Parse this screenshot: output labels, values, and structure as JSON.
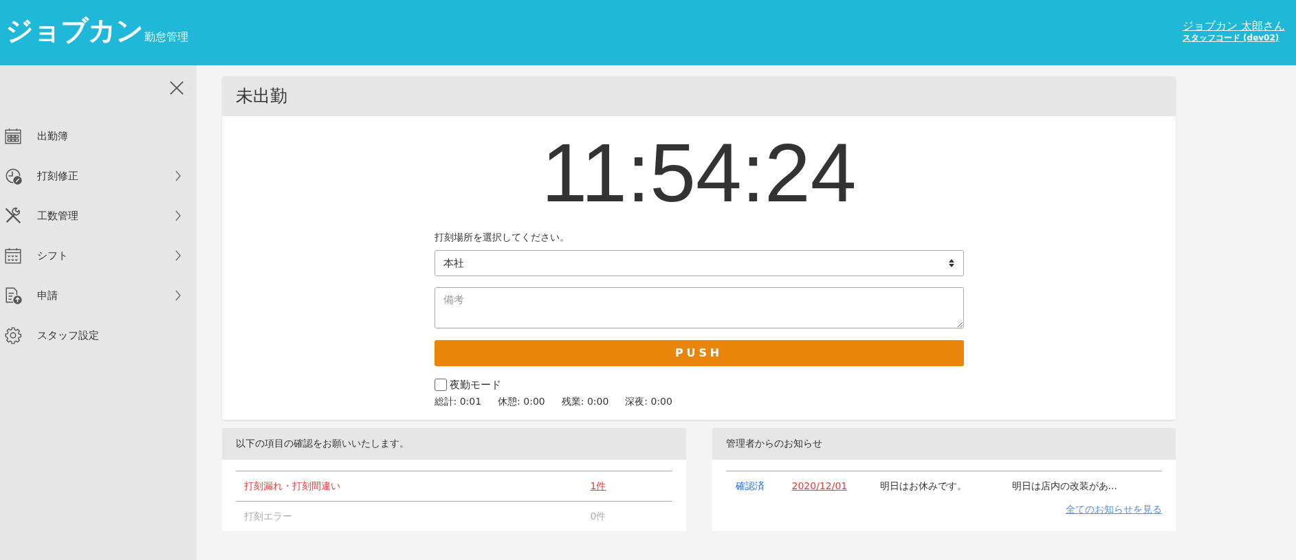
{
  "header": {
    "logo": "ジョブカン",
    "logo_sub": "勤怠管理",
    "user_name": "ジョブカン 太郎さん",
    "staff_code": "スタッフコード (dev02)"
  },
  "sidebar": {
    "items": [
      {
        "label": "出勤簿",
        "kind": "calendar",
        "has_submenu": false
      },
      {
        "label": "打刻修正",
        "kind": "clock",
        "has_submenu": true
      },
      {
        "label": "工数管理",
        "kind": "tools",
        "has_submenu": true
      },
      {
        "label": "シフト",
        "kind": "shift",
        "has_submenu": true
      },
      {
        "label": "申請",
        "kind": "document",
        "has_submenu": true
      },
      {
        "label": "スタッフ設定",
        "kind": "gear",
        "has_submenu": false
      }
    ]
  },
  "status_card": {
    "title": "未出勤",
    "clock": "11:54:24",
    "location_label": "打刻場所を選択してください。",
    "location_value": "本社",
    "note_placeholder": "備考",
    "push_button": "PUSH",
    "night_mode": {
      "label": "夜勤モード",
      "checked": false
    },
    "totals": [
      "総計: 0:01",
      "休憩: 0:00",
      "残業: 0:00",
      "深夜: 0:00"
    ]
  },
  "check_panel": {
    "title": "以下の項目の確認をお願いいたします。",
    "rows": [
      {
        "label": "打刻漏れ・打刻間違い",
        "count": "1件",
        "alert": true
      },
      {
        "label": "打刻エラー",
        "count": "0件",
        "alert": false
      }
    ]
  },
  "notice_panel": {
    "title": "管理者からのお知らせ",
    "rows": [
      {
        "status": "確認済",
        "date": "2020/12/01",
        "subject": "明日はお休みです。",
        "preview": "明日は店内の改装があ..."
      }
    ],
    "more_link": "全てのお知らせを見る"
  }
}
